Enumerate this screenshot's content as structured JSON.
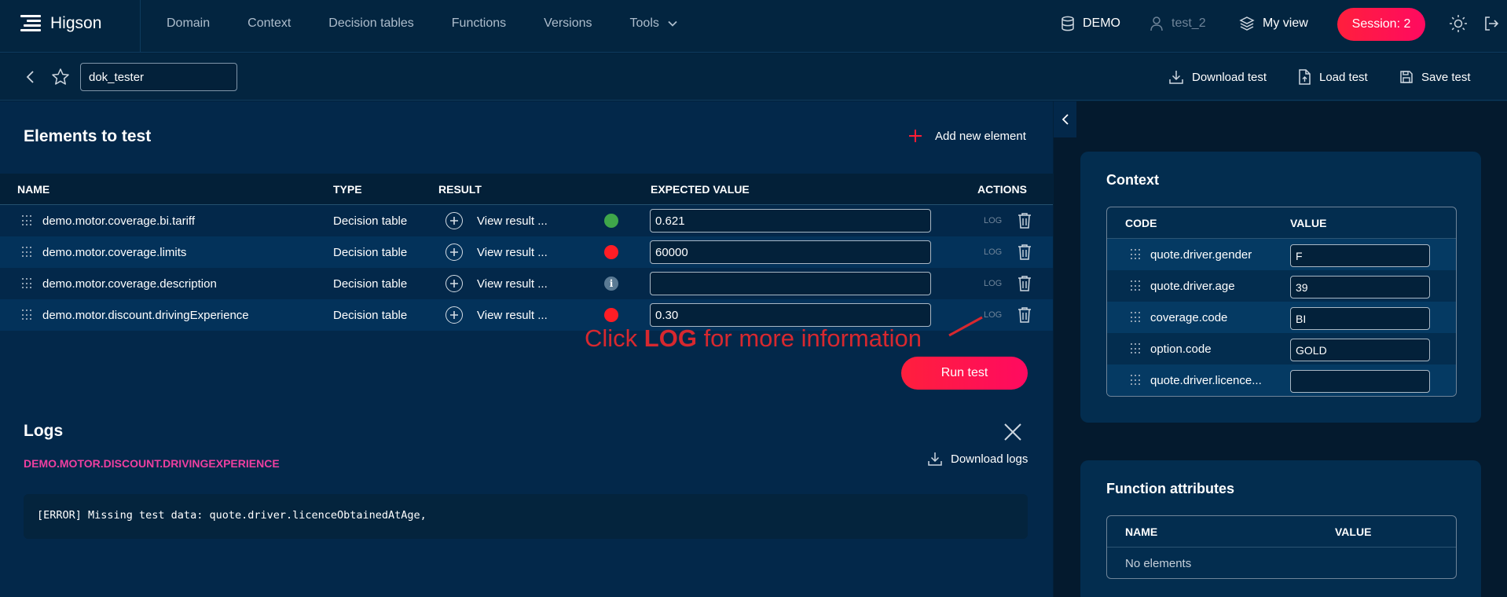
{
  "app": {
    "logo_text": "Higson",
    "nav": [
      "Domain",
      "Context",
      "Decision tables",
      "Functions",
      "Versions",
      "Tools"
    ],
    "environment": "DEMO",
    "user": "test_2",
    "view": "My view",
    "session": "Session: 2"
  },
  "toolbar": {
    "test_name": "dok_tester",
    "download_test": "Download test",
    "load_test": "Load test",
    "save_test": "Save test"
  },
  "elements": {
    "title": "Elements to test",
    "add_new": "Add new element",
    "columns": {
      "name": "NAME",
      "type": "TYPE",
      "result": "RESULT",
      "expected": "EXPECTED VALUE",
      "actions": "ACTIONS"
    },
    "rows": [
      {
        "name": "demo.motor.coverage.bi.tariff",
        "type": "Decision table",
        "result": "View result ...",
        "status": "success",
        "expected": "0.621",
        "log": "LOG"
      },
      {
        "name": "demo.motor.coverage.limits",
        "type": "Decision table",
        "result": "View result ...",
        "status": "error",
        "expected": "60000",
        "log": "LOG"
      },
      {
        "name": "demo.motor.coverage.description",
        "type": "Decision table",
        "result": "View result ...",
        "status": "info",
        "expected": "",
        "log": "LOG"
      },
      {
        "name": "demo.motor.discount.drivingExperience",
        "type": "Decision table",
        "result": "View result ...",
        "status": "error",
        "expected": "0.30",
        "log": "LOG"
      }
    ],
    "annotation_pre": "Click ",
    "annotation_bold": "LOG",
    "annotation_post": " for more information",
    "run_test": "Run test"
  },
  "logs": {
    "title": "Logs",
    "element_key": "DEMO.MOTOR.DISCOUNT.DRIVINGEXPERIENCE",
    "download": "Download logs",
    "message": "[ERROR] Missing test data: quote.driver.licenceObtainedAtAge,"
  },
  "context": {
    "title": "Context",
    "columns": {
      "code": "CODE",
      "value": "VALUE"
    },
    "rows": [
      {
        "code": "quote.driver.gender",
        "value": "F"
      },
      {
        "code": "quote.driver.age",
        "value": "39"
      },
      {
        "code": "coverage.code",
        "value": "BI"
      },
      {
        "code": "option.code",
        "value": "GOLD"
      },
      {
        "code": "quote.driver.licence...",
        "value": ""
      }
    ]
  },
  "function_attributes": {
    "title": "Function attributes",
    "columns": {
      "name": "NAME",
      "value": "VALUE"
    },
    "empty": "No elements"
  },
  "colors": {
    "accent": "#ff0a50",
    "success": "#3fa64a",
    "error": "#ff1d25",
    "log_key": "#ef3fa0"
  }
}
